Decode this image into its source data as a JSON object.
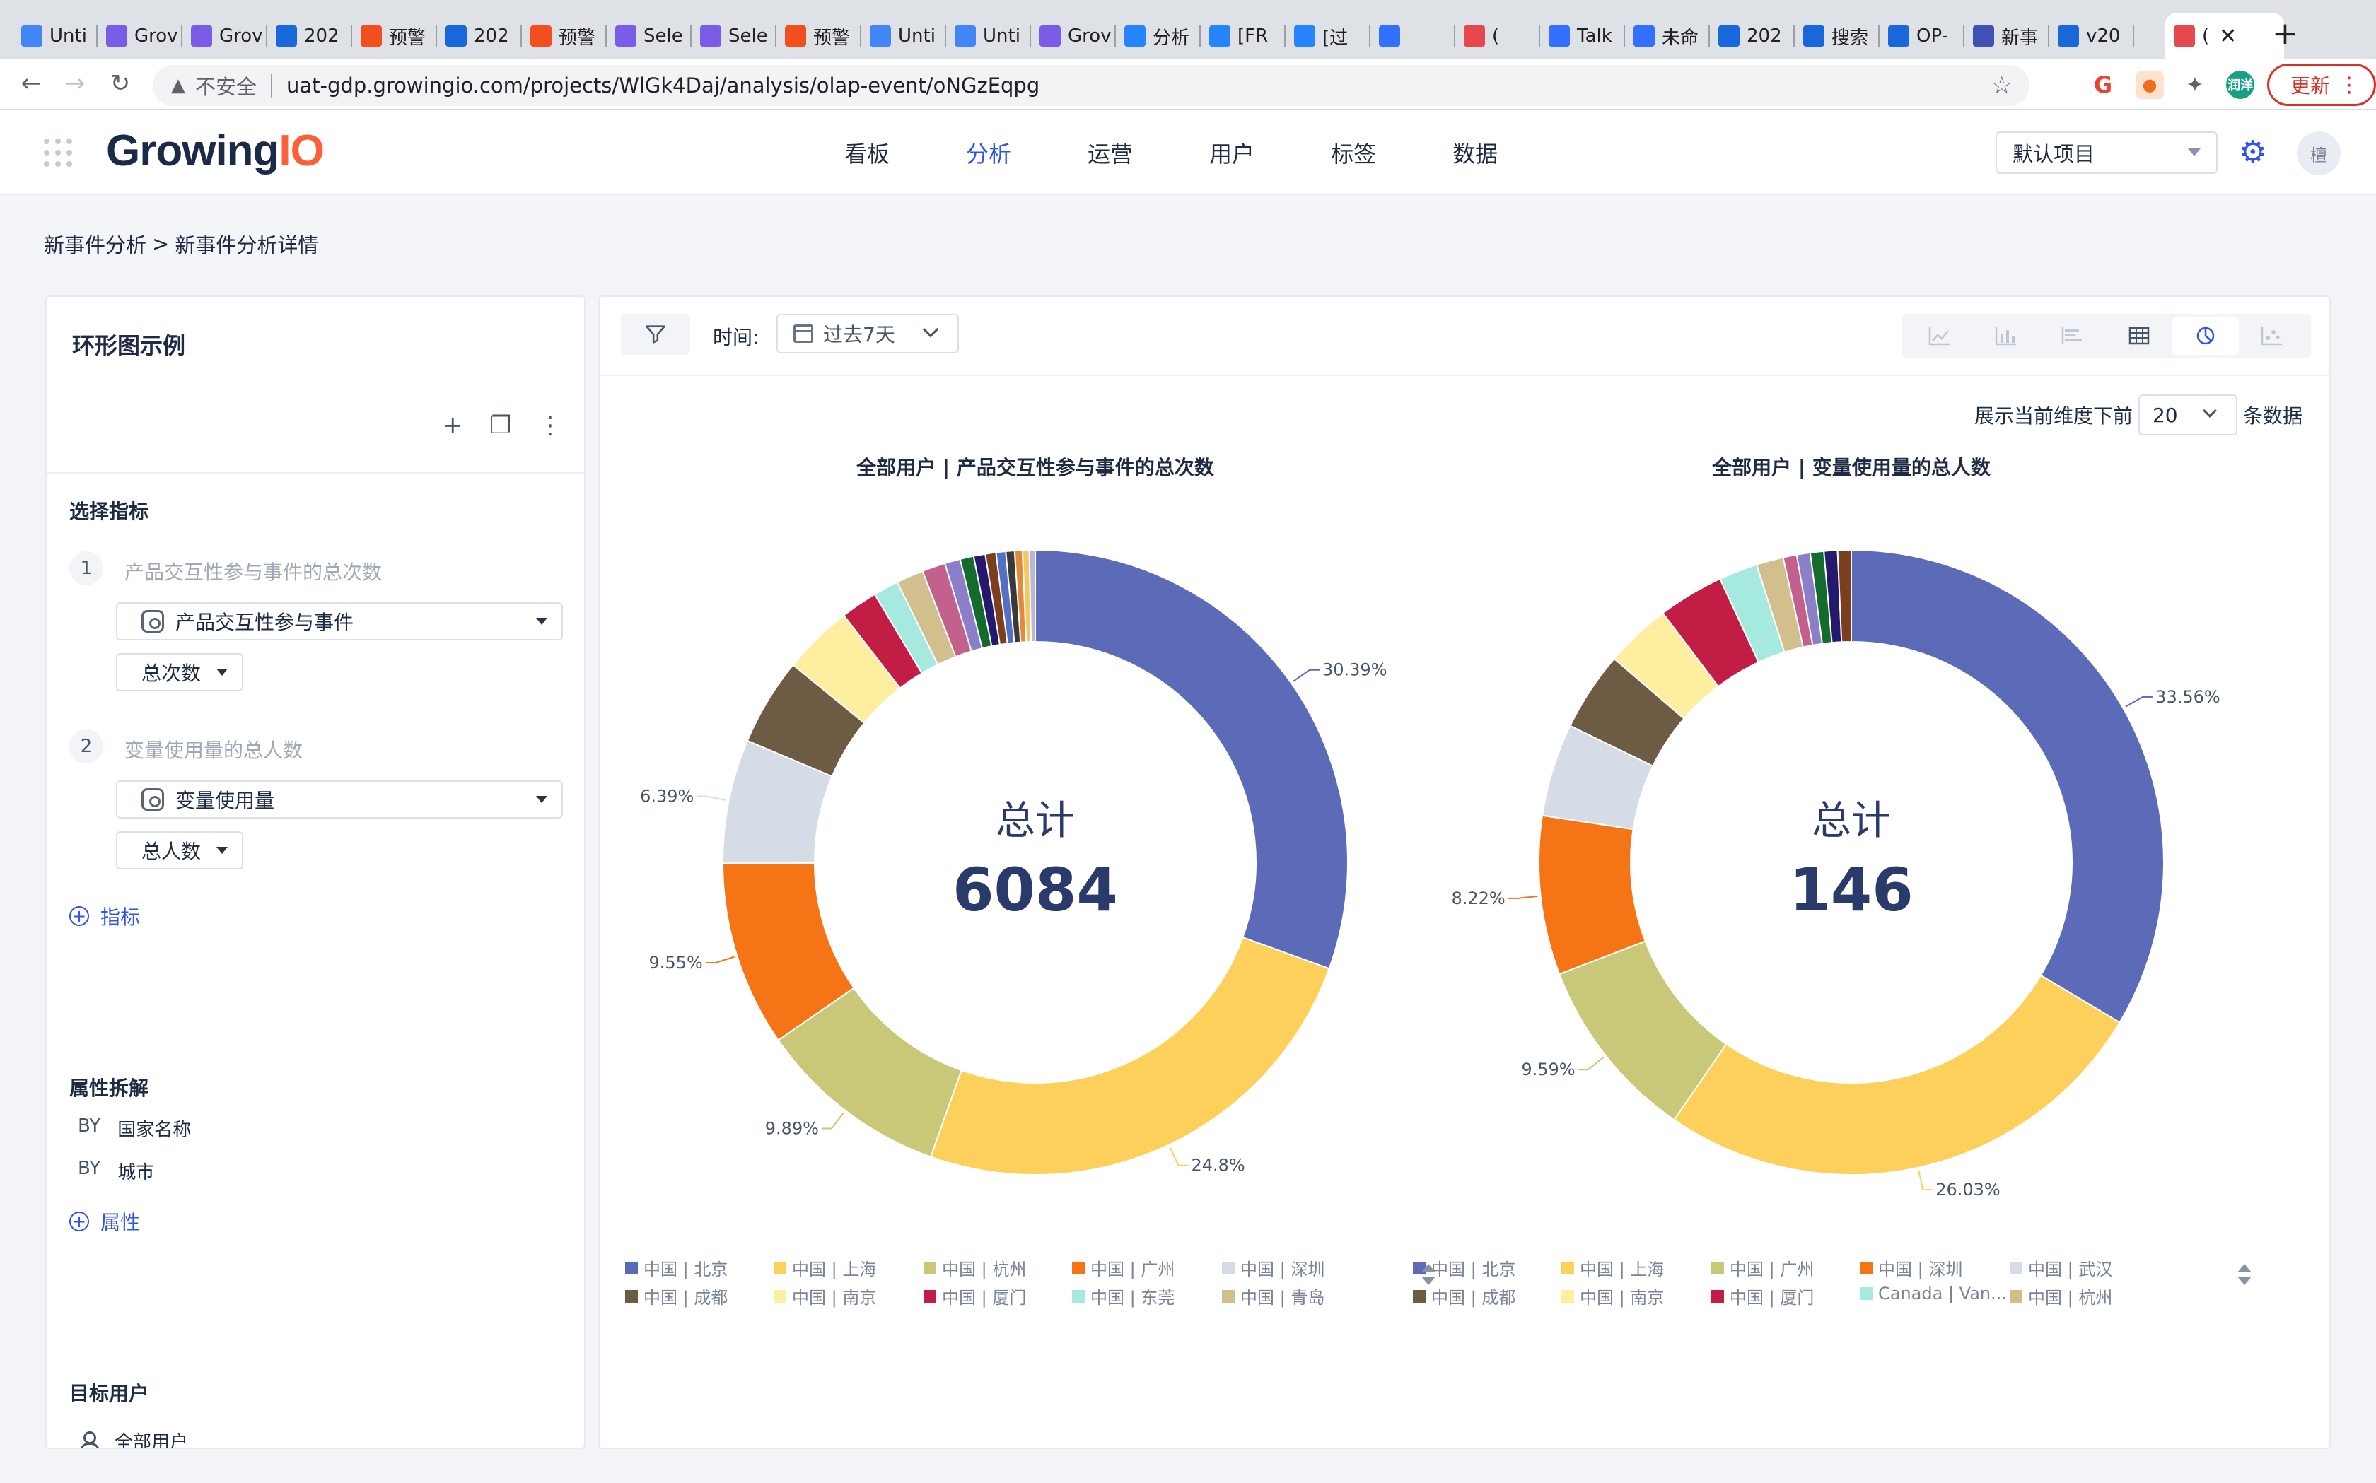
{
  "browser": {
    "tabs": [
      {
        "label": "Unti",
        "icon": "docs-icon",
        "color": "#4285f4"
      },
      {
        "label": "Grov",
        "icon": "bars-icon",
        "color": "#7b5ce6"
      },
      {
        "label": "Grov",
        "icon": "bars-icon",
        "color": "#7b5ce6"
      },
      {
        "label": "202",
        "icon": "confluence-icon",
        "color": "#1868db"
      },
      {
        "label": "预警",
        "icon": "figma-icon",
        "color": "#f24e1e"
      },
      {
        "label": "202",
        "icon": "confluence-icon",
        "color": "#1868db"
      },
      {
        "label": "预警",
        "icon": "figma-icon",
        "color": "#f24e1e"
      },
      {
        "label": "Sele",
        "icon": "bars-icon",
        "color": "#7b5ce6"
      },
      {
        "label": "Sele",
        "icon": "bars-icon",
        "color": "#7b5ce6"
      },
      {
        "label": "预警",
        "icon": "figma-icon",
        "color": "#f24e1e"
      },
      {
        "label": "Unti",
        "icon": "docs-icon",
        "color": "#4285f4"
      },
      {
        "label": "Unti",
        "icon": "docs-icon",
        "color": "#4285f4"
      },
      {
        "label": "Grov",
        "icon": "bars-icon",
        "color": "#7b5ce6"
      },
      {
        "label": "分析",
        "icon": "jira-icon",
        "color": "#2684ff"
      },
      {
        "label": "[FR",
        "icon": "jira-icon",
        "color": "#2684ff"
      },
      {
        "label": "[过",
        "icon": "jira-icon",
        "color": "#2684ff"
      },
      {
        "label": "",
        "icon": "lark-doc-icon",
        "color": "#3370ff"
      },
      {
        "label": "(",
        "icon": "target-icon",
        "color": "#e5484d"
      },
      {
        "label": "Talk",
        "icon": "lark-doc-icon",
        "color": "#3370ff"
      },
      {
        "label": "未命",
        "icon": "lark-doc-icon",
        "color": "#3370ff"
      },
      {
        "label": "202",
        "icon": "confluence-icon",
        "color": "#1868db"
      },
      {
        "label": "搜索",
        "icon": "confluence-icon",
        "color": "#1868db"
      },
      {
        "label": "OP-",
        "icon": "confluence-icon",
        "color": "#1868db"
      },
      {
        "label": "新事",
        "icon": "cap-icon",
        "color": "#3f51b5"
      },
      {
        "label": "v20",
        "icon": "confluence-icon",
        "color": "#1868db"
      },
      {
        "label": "(",
        "icon": "bars-icon",
        "color": "#e5484d",
        "active": true
      }
    ],
    "insecure_label": "不安全",
    "url": "uat-gdp.growingio.com/projects/WlGk4Daj/analysis/olap-event/oNGzEqpg",
    "profile_label": "润洋",
    "update_label": "更新"
  },
  "app": {
    "logo_main": "Growing",
    "logo_accent": "IO",
    "nav": [
      "看板",
      "分析",
      "运营",
      "用户",
      "标签",
      "数据"
    ],
    "active_nav": 1,
    "project": "默认项目",
    "avatar": "檀"
  },
  "breadcrumb": {
    "parent": "新事件分析",
    "separator": ">",
    "current": "新事件分析详情"
  },
  "left": {
    "title": "环形图示例",
    "metrics_title": "选择指标",
    "metrics": [
      {
        "num": "1",
        "label": "产品交互性参与事件的总次数",
        "event": "产品交互性参与事件",
        "agg": "总次数"
      },
      {
        "num": "2",
        "label": "变量使用量的总人数",
        "event": "变量使用量",
        "agg": "总人数"
      }
    ],
    "add_metric": "指标",
    "breakdown_title": "属性拆解",
    "breakdown": [
      {
        "by": "BY",
        "name": "国家名称"
      },
      {
        "by": "BY",
        "name": "城市"
      }
    ],
    "add_property": "属性",
    "target_title": "目标用户",
    "target_user": "全部用户"
  },
  "right": {
    "time_label": "时间:",
    "date_range": "过去7天",
    "limit_prefix": "展示当前维度下前",
    "limit_value": "20",
    "limit_suffix": "条数据"
  },
  "chart_data": [
    {
      "type": "pie",
      "variant": "donut",
      "title": "全部用户 | 产品交互性参与事件的总次数",
      "center_label": "总计",
      "center_value": "6084",
      "slices": [
        {
          "label": "中国 | 北京",
          "value": 30.39,
          "color": "#5b6bb8"
        },
        {
          "label": "中国 | 上海",
          "value": 24.8,
          "color": "#fcd05a"
        },
        {
          "label": "中国 | 杭州",
          "value": 9.89,
          "color": "#c9c778"
        },
        {
          "label": "中国 | 广州",
          "value": 9.55,
          "color": "#f57516"
        },
        {
          "label": "中国 | 深圳",
          "value": 6.39,
          "color": "#d6dce5"
        },
        {
          "label": "中国 | 成都",
          "value": 4.5,
          "color": "#6e5b44"
        },
        {
          "label": "中国 | 南京",
          "value": 3.6,
          "color": "#fdeea0"
        },
        {
          "label": "中国 | 厦门",
          "value": 1.9,
          "color": "#c21d44"
        },
        {
          "label": "中国 | 东莞",
          "value": 1.3,
          "color": "#a6eadf"
        },
        {
          "label": "中国 | 青岛",
          "value": 1.4,
          "color": "#d1bf8e"
        },
        {
          "label": "",
          "value": 1.2,
          "color": "#c2618b"
        },
        {
          "label": "",
          "value": 0.8,
          "color": "#8b7fc9"
        },
        {
          "label": "",
          "value": 0.7,
          "color": "#136b2c"
        },
        {
          "label": "",
          "value": 0.6,
          "color": "#25196e"
        },
        {
          "label": "",
          "value": 0.55,
          "color": "#7b3f1e"
        },
        {
          "label": "",
          "value": 0.5,
          "color": "#5470c6"
        },
        {
          "label": "",
          "value": 0.45,
          "color": "#3a3a3a"
        },
        {
          "label": "",
          "value": 0.4,
          "color": "#e08a3c"
        },
        {
          "label": "",
          "value": 0.35,
          "color": "#f3c766"
        },
        {
          "label": "",
          "value": 0.3,
          "color": "#b8b5dc"
        }
      ],
      "shown_labels": [
        "30.39%",
        "24.8%",
        "9.89%",
        "9.55%",
        "6.39%"
      ],
      "legend": [
        "中国 | 北京",
        "中国 | 上海",
        "中国 | 杭州",
        "中国 | 广州",
        "中国 | 深圳",
        "中国 | 成都",
        "中国 | 南京",
        "中国 | 厦门",
        "中国 | 东莞",
        "中国 | 青岛"
      ]
    },
    {
      "type": "pie",
      "variant": "donut",
      "title": "全部用户 | 变量使用量的总人数",
      "center_label": "总计",
      "center_value": "146",
      "slices": [
        {
          "label": "中国 | 北京",
          "value": 33.56,
          "color": "#5b6bb8"
        },
        {
          "label": "中国 | 上海",
          "value": 26.03,
          "color": "#fcd05a"
        },
        {
          "label": "中国 | 广州",
          "value": 9.59,
          "color": "#c9c778"
        },
        {
          "label": "中国 | 深圳",
          "value": 8.22,
          "color": "#f57516"
        },
        {
          "label": "中国 | 武汉",
          "value": 4.8,
          "color": "#d6dce5"
        },
        {
          "label": "中国 | 成都",
          "value": 4.1,
          "color": "#6e5b44"
        },
        {
          "label": "中国 | 南京",
          "value": 3.4,
          "color": "#fdeea0"
        },
        {
          "label": "中国 | 厦门",
          "value": 3.4,
          "color": "#c21d44"
        },
        {
          "label": "Canada | Van...",
          "value": 2.0,
          "color": "#a6eadf"
        },
        {
          "label": "中国 | 杭州",
          "value": 1.4,
          "color": "#d1bf8e"
        },
        {
          "label": "",
          "value": 0.7,
          "color": "#c2618b"
        },
        {
          "label": "",
          "value": 0.7,
          "color": "#8b7fc9"
        },
        {
          "label": "",
          "value": 0.7,
          "color": "#136b2c"
        },
        {
          "label": "",
          "value": 0.7,
          "color": "#25196e"
        },
        {
          "label": "",
          "value": 0.7,
          "color": "#7b3f1e"
        }
      ],
      "shown_labels": [
        "33.56%",
        "26.03%",
        "9.59%",
        "8.22%"
      ],
      "legend": [
        "中国 | 北京",
        "中国 | 上海",
        "中国 | 广州",
        "中国 | 深圳",
        "中国 | 武汉",
        "中国 | 成都",
        "中国 | 南京",
        "中国 | 厦门",
        "Canada | Van...",
        "中国 | 杭州"
      ]
    }
  ]
}
